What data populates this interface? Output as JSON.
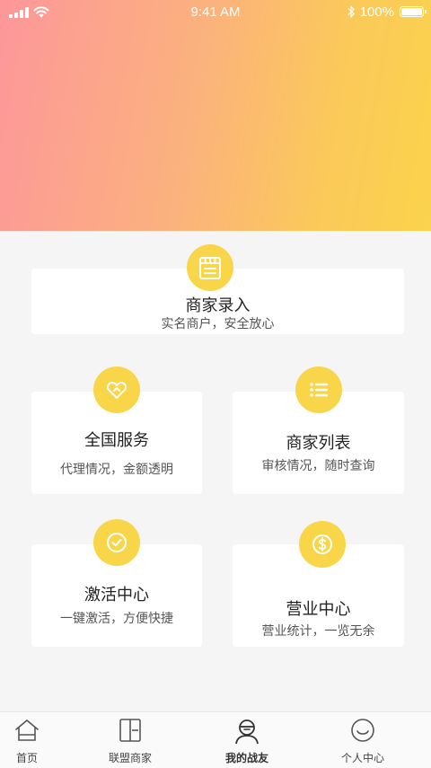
{
  "status_bar": {
    "time": "9:41 AM",
    "battery": "100%"
  },
  "cards": {
    "merchant_entry": {
      "title": "商家录入",
      "subtitle": "实名商户，安全放心",
      "icon": "storefront-icon"
    },
    "national_service": {
      "title": "全国服务",
      "subtitle": "代理情况，金额透明",
      "icon": "heart-icon"
    },
    "merchant_list": {
      "title": "商家列表",
      "subtitle": "审核情况，随时查询",
      "icon": "list-icon"
    },
    "activation_center": {
      "title": "激活中心",
      "subtitle": "一键激活，方便快捷",
      "icon": "check-circle-icon"
    },
    "business_center": {
      "title": "营业中心",
      "subtitle": "营业统计，一览无余",
      "icon": "dollar-coin-icon"
    }
  },
  "tabbar": {
    "items": [
      {
        "label": "首页",
        "icon": "home-icon"
      },
      {
        "label": "联盟商家",
        "icon": "merchant-icon"
      },
      {
        "label": "我的战友",
        "icon": "comrade-icon",
        "active": true
      },
      {
        "label": "个人中心",
        "icon": "smile-icon"
      }
    ]
  },
  "colors": {
    "accent": "#f9d54a",
    "hero_start": "#fd979a",
    "hero_end": "#fbd34b",
    "background": "#f5f5f5"
  }
}
